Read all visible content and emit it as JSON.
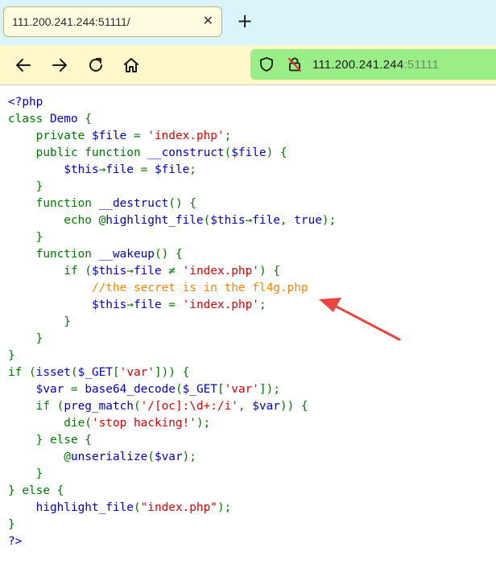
{
  "browser": {
    "tab_title": "111.200.241.244:51111/",
    "tab_close": "✕",
    "new_tab": "+",
    "url_host": "111.200.241.244",
    "url_port": ":51111"
  },
  "code_lines": [
    [
      [
        "html",
        "<?php"
      ]
    ],
    [
      [
        "kw",
        "class "
      ],
      [
        "def",
        "Demo"
      ],
      [
        "kw",
        " {"
      ]
    ],
    [
      [
        "kw",
        "    private "
      ],
      [
        "var",
        "$file"
      ],
      [
        "kw",
        " = "
      ],
      [
        "str",
        "'index.php'"
      ],
      [
        "kw",
        ";"
      ]
    ],
    [
      [
        "kw",
        "    public function "
      ],
      [
        "def",
        "__construct"
      ],
      [
        "kw",
        "("
      ],
      [
        "var",
        "$file"
      ],
      [
        "kw",
        ") {"
      ]
    ],
    [
      [
        "kw",
        "        "
      ],
      [
        "var",
        "$this"
      ],
      [
        "kw",
        "→"
      ],
      [
        "def",
        "file"
      ],
      [
        "kw",
        " = "
      ],
      [
        "var",
        "$file"
      ],
      [
        "kw",
        ";"
      ]
    ],
    [
      [
        "kw",
        "    }"
      ]
    ],
    [
      [
        "kw",
        "    function "
      ],
      [
        "def",
        "__destruct"
      ],
      [
        "kw",
        "() {"
      ]
    ],
    [
      [
        "kw",
        "        echo @"
      ],
      [
        "def",
        "highlight_file"
      ],
      [
        "kw",
        "("
      ],
      [
        "var",
        "$this"
      ],
      [
        "kw",
        "→"
      ],
      [
        "def",
        "file"
      ],
      [
        "kw",
        ", "
      ],
      [
        "def",
        "true"
      ],
      [
        "kw",
        ");"
      ]
    ],
    [
      [
        "kw",
        "    }"
      ]
    ],
    [
      [
        "kw",
        "    function "
      ],
      [
        "def",
        "__wakeup"
      ],
      [
        "kw",
        "() {"
      ]
    ],
    [
      [
        "kw",
        "        if ("
      ],
      [
        "var",
        "$this"
      ],
      [
        "kw",
        "→"
      ],
      [
        "def",
        "file"
      ],
      [
        "kw",
        " ≠ "
      ],
      [
        "str",
        "'index.php'"
      ],
      [
        "kw",
        ") {"
      ]
    ],
    [
      [
        "kw",
        "            "
      ],
      [
        "cmt",
        "//the secret is in the fl4g.php"
      ]
    ],
    [
      [
        "kw",
        "            "
      ],
      [
        "var",
        "$this"
      ],
      [
        "kw",
        "→"
      ],
      [
        "def",
        "file"
      ],
      [
        "kw",
        " = "
      ],
      [
        "str",
        "'index.php'"
      ],
      [
        "kw",
        ";"
      ]
    ],
    [
      [
        "kw",
        "        }"
      ]
    ],
    [
      [
        "kw",
        "    }"
      ]
    ],
    [
      [
        "kw",
        "}"
      ]
    ],
    [
      [
        "kw",
        "if ("
      ],
      [
        "def",
        "isset"
      ],
      [
        "kw",
        "("
      ],
      [
        "var",
        "$_GET"
      ],
      [
        "kw",
        "["
      ],
      [
        "str",
        "'var'"
      ],
      [
        "kw",
        "])) {"
      ]
    ],
    [
      [
        "kw",
        "    "
      ],
      [
        "var",
        "$var"
      ],
      [
        "kw",
        " = "
      ],
      [
        "def",
        "base64_decode"
      ],
      [
        "kw",
        "("
      ],
      [
        "var",
        "$_GET"
      ],
      [
        "kw",
        "["
      ],
      [
        "str",
        "'var'"
      ],
      [
        "kw",
        "]);"
      ]
    ],
    [
      [
        "kw",
        "    if ("
      ],
      [
        "def",
        "preg_match"
      ],
      [
        "kw",
        "("
      ],
      [
        "str",
        "'/[oc]:\\d+:/i'"
      ],
      [
        "kw",
        ", "
      ],
      [
        "var",
        "$var"
      ],
      [
        "kw",
        ")) {"
      ]
    ],
    [
      [
        "kw",
        "        die("
      ],
      [
        "str",
        "'stop hacking!'"
      ],
      [
        "kw",
        ");"
      ]
    ],
    [
      [
        "kw",
        "    } else {"
      ]
    ],
    [
      [
        "kw",
        "        @"
      ],
      [
        "def",
        "unserialize"
      ],
      [
        "kw",
        "("
      ],
      [
        "var",
        "$var"
      ],
      [
        "kw",
        ");"
      ]
    ],
    [
      [
        "kw",
        "    }"
      ]
    ],
    [
      [
        "kw",
        "} else {"
      ]
    ],
    [
      [
        "kw",
        "    "
      ],
      [
        "def",
        "highlight_file"
      ],
      [
        "kw",
        "("
      ],
      [
        "str",
        "\"index.php\""
      ],
      [
        "kw",
        ");"
      ]
    ],
    [
      [
        "kw",
        "}"
      ]
    ],
    [
      [
        "html",
        "?>"
      ]
    ]
  ],
  "colors": {
    "tabstrip": "#d9f4fb",
    "toolbar": "#fff7cc",
    "urlbar": "#99ee88",
    "keyword": "#007700",
    "string": "#dd0000",
    "identifier": "#0000bb",
    "comment": "#ff8000",
    "annotation_arrow": "#e8463e"
  }
}
